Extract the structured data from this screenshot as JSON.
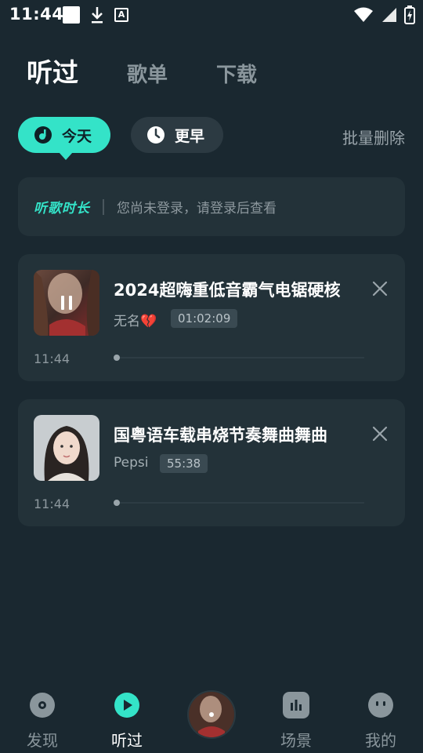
{
  "status_bar": {
    "time": "11:44"
  },
  "tabs": [
    {
      "label": "听过",
      "active": true
    },
    {
      "label": "歌单",
      "active": false
    },
    {
      "label": "下载",
      "active": false
    }
  ],
  "filters": {
    "today": "今天",
    "earlier": "更早",
    "batch_delete": "批量删除"
  },
  "listen_duration": {
    "title": "听歌时长",
    "hint": "您尚未登录，请登录后查看"
  },
  "songs": [
    {
      "title": "2024超嗨重低音霸气电锯硬核",
      "artist": "无名💔",
      "duration": "01:02:09",
      "played_at": "11:44",
      "playing": true
    },
    {
      "title": "国粤语车载串烧节奏舞曲舞曲",
      "artist": "Pepsi",
      "duration": "55:38",
      "played_at": "11:44",
      "playing": false
    }
  ],
  "bottom_nav": [
    {
      "label": "发现",
      "icon": "disc-icon"
    },
    {
      "label": "听过",
      "icon": "play-circle-icon",
      "active": true
    },
    {
      "label": "场景",
      "icon": "bars-icon"
    },
    {
      "label": "我的",
      "icon": "face-icon"
    }
  ],
  "colors": {
    "accent": "#34e3c8",
    "background": "#1a2830",
    "card": "#233239"
  }
}
